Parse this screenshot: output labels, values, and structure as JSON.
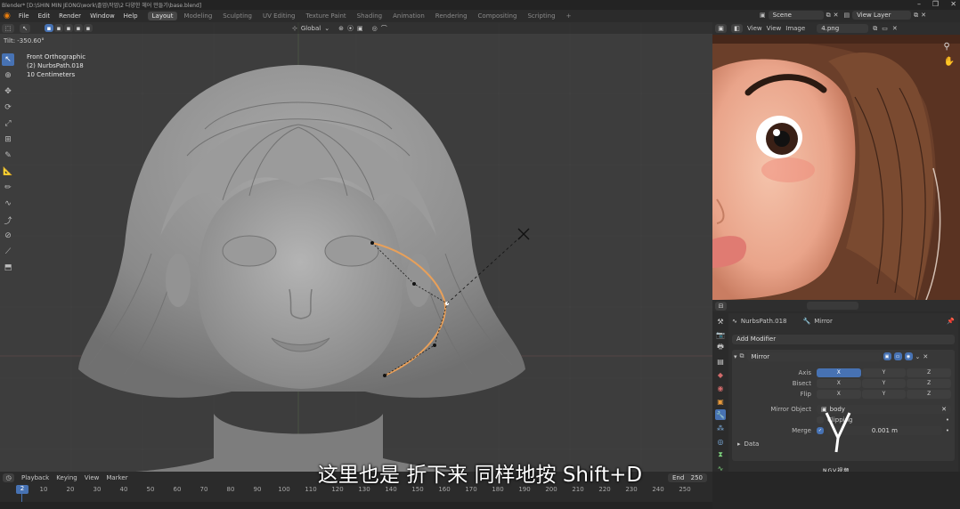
{
  "window": {
    "title": "Blender* [D:\\SHIN MIN JEONG\\work\\졸업\\작업\\2 다양한 헤어 만들기\\base.blend]"
  },
  "menu": [
    "File",
    "Edit",
    "Render",
    "Window",
    "Help"
  ],
  "workspaces": [
    "Layout",
    "Modeling",
    "Sculpting",
    "UV Editing",
    "Texture Paint",
    "Shading",
    "Animation",
    "Rendering",
    "Compositing",
    "Scripting"
  ],
  "workspace_add": "+",
  "scene": {
    "label": "Scene",
    "view_layer": "View Layer"
  },
  "viewport": {
    "transform_orientation": "Global",
    "tilt": "Tilt: -350.60°",
    "info": [
      "Front Orthographic",
      "(2) NurbsPath.018",
      "10 Centimeters"
    ]
  },
  "image_editor": {
    "view_menu": "View",
    "view2": "View",
    "image_menu": "Image",
    "image_name": "4.png"
  },
  "properties": {
    "object_name": "NurbsPath.018",
    "modifier_ref": "Mirror",
    "add_modifier": "Add Modifier",
    "modifier_name": "Mirror",
    "axis_label": "Axis",
    "bisect_label": "Bisect",
    "flip_label": "Flip",
    "x": "X",
    "y": "Y",
    "z": "Z",
    "mirror_object_label": "Mirror Object",
    "mirror_object_value": "body",
    "clipping_label": "Clipping",
    "merge_label": "Merge",
    "merge_value": "0.001 m",
    "data_label": "Data"
  },
  "timeline": {
    "menus": [
      "Playback",
      "Keying",
      "View",
      "Marker"
    ],
    "end_label": "End",
    "end_value": "250",
    "current_frame": "2",
    "ticks": [
      "10",
      "20",
      "30",
      "40",
      "50",
      "60",
      "70",
      "80",
      "90",
      "100",
      "110",
      "120",
      "130",
      "140",
      "150",
      "160",
      "170",
      "180",
      "190",
      "200",
      "210",
      "220",
      "230",
      "240",
      "250"
    ]
  },
  "subtitle": "这里也是 折下来 同样地按 Shift+D",
  "watermark": "NGV视频",
  "colors": {
    "accent": "#4772b3",
    "curve": "#e8a05a",
    "viewport_bg": "#3d3d3d"
  }
}
